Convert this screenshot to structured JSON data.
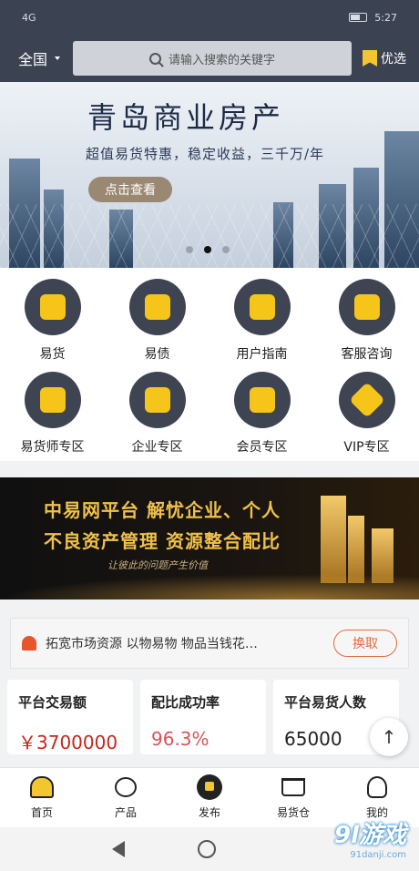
{
  "status": {
    "carrier": "4G",
    "time": "5:27"
  },
  "header": {
    "region": "全国",
    "search_placeholder": "请输入搜索的关键字",
    "pref_label": "优选"
  },
  "banner": {
    "title": "青岛商业房产",
    "subtitle": "超值易货特惠，稳定收益，三千万/年",
    "button": "点击查看"
  },
  "menu": [
    {
      "label": "易货",
      "icon": "bag-icon"
    },
    {
      "label": "易债",
      "icon": "coin-icon"
    },
    {
      "label": "用户指南",
      "icon": "document-icon"
    },
    {
      "label": "客服咨询",
      "icon": "headset-icon"
    },
    {
      "label": "易货师专区",
      "icon": "person-icon"
    },
    {
      "label": "企业专区",
      "icon": "book-icon"
    },
    {
      "label": "会员专区",
      "icon": "card-icon"
    },
    {
      "label": "VIP专区",
      "icon": "diamond-icon"
    }
  ],
  "promo": {
    "line1": "中易网平台 解忧企业、个人",
    "line2": "不良资产管理 资源整合配比",
    "line3": "让彼此的问题产生价值"
  },
  "notice": {
    "text": "拓宽市场资源 以物易物 物品当钱花…",
    "button": "换取"
  },
  "stats": [
    {
      "label": "平台交易额",
      "value": "￥3700000"
    },
    {
      "label": "配比成功率",
      "value": "96.3%"
    },
    {
      "label": "平台易货人数",
      "value": "65000"
    }
  ],
  "tabs": [
    "首页",
    "产品",
    "发布",
    "易货仓",
    "我的"
  ],
  "watermark": {
    "main": "9l游戏",
    "sub": "91danji.com"
  },
  "colors": {
    "header_bg": "#3b4252",
    "accent_yellow": "#f5c51a",
    "price_red": "#c9251c",
    "notice_orange": "#e36b3b"
  }
}
